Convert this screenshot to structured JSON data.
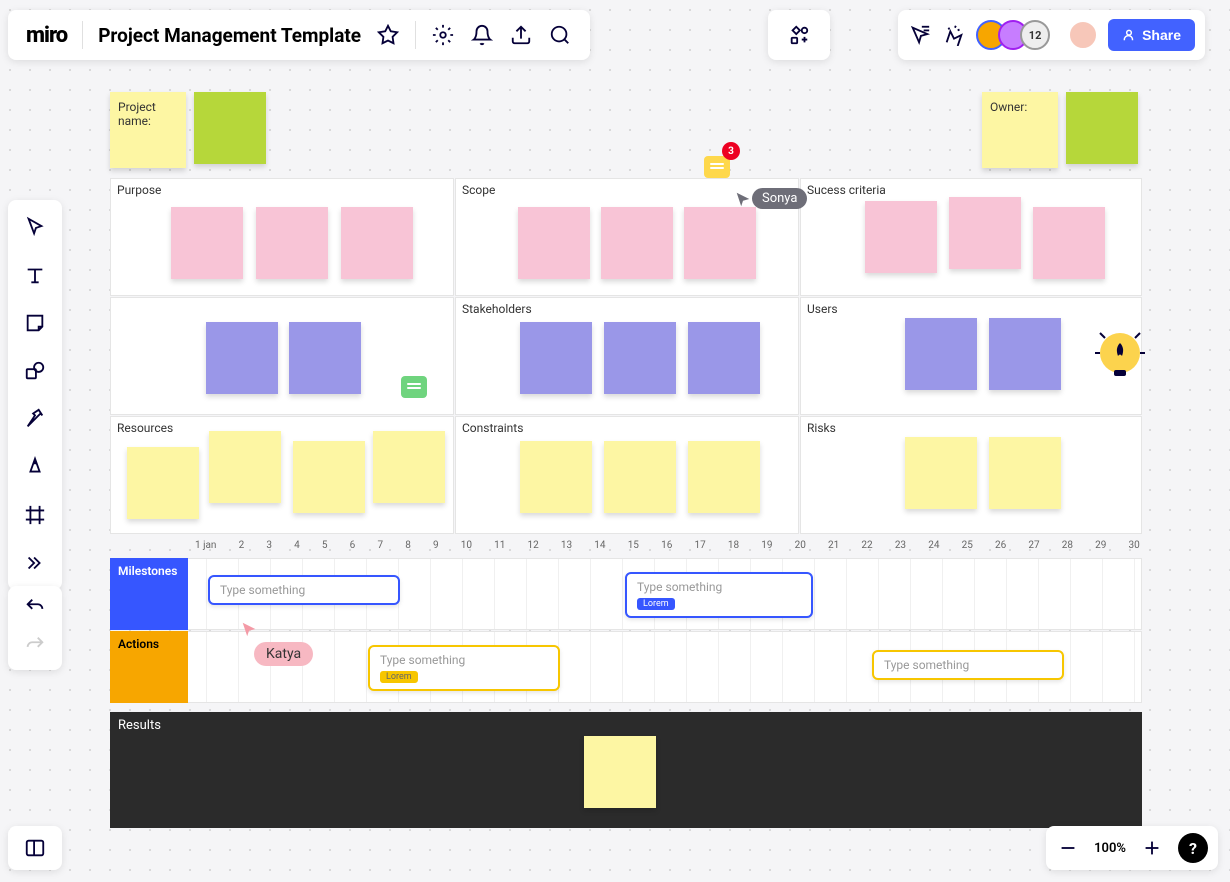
{
  "logo": "miro",
  "board_title": "Project Management Template",
  "share_label": "Share",
  "avatar_count": "12",
  "zoom_level": "100%",
  "comment_badge": "3",
  "project_name_label": "Project name:",
  "owner_label": "Owner:",
  "sections": {
    "purpose": "Purpose",
    "scope": "Scope",
    "success": "Sucess criteria",
    "stakeholders": "Stakeholders",
    "users": "Users",
    "resources": "Resources",
    "constraints": "Constraints",
    "risks": "Risks"
  },
  "timeline": {
    "milestones_label": "Milestones",
    "actions_label": "Actions",
    "results_label": "Results",
    "dates": [
      "1 jan",
      "2",
      "3",
      "4",
      "5",
      "6",
      "7",
      "8",
      "9",
      "10",
      "11",
      "12",
      "13",
      "14",
      "15",
      "16",
      "17",
      "18",
      "19",
      "20",
      "21",
      "22",
      "23",
      "24",
      "25",
      "26",
      "27",
      "28",
      "29",
      "30"
    ]
  },
  "cards": {
    "placeholder": "Type something",
    "tag_lorem": "Lorem"
  },
  "cursors": {
    "sonya": "Sonya",
    "katya": "Katya"
  },
  "help_label": "?"
}
